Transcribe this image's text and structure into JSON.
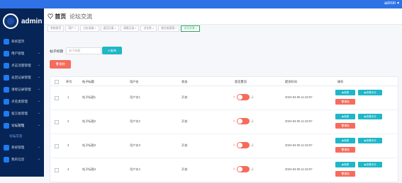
{
  "topbar": {
    "user": "admin ▾"
  },
  "sidebar": {
    "brand": "admin",
    "items": [
      {
        "label": "系统首页",
        "icon": "home-icon",
        "caret": false
      },
      {
        "label": "用户管理",
        "icon": "user-icon",
        "caret": true
      },
      {
        "label": "点击流量管理",
        "icon": "chart-icon",
        "caret": true
      },
      {
        "label": "返回记录管理",
        "icon": "list-icon",
        "caret": true
      },
      {
        "label": "请假记录管理",
        "icon": "doc-icon",
        "caret": true
      },
      {
        "label": "点名类管理",
        "icon": "tag-icon",
        "caret": true
      },
      {
        "label": "留言板管理",
        "icon": "msg-icon",
        "caret": true
      },
      {
        "label": "论坛管理",
        "icon": "forum-icon",
        "caret": true,
        "active": true
      },
      {
        "label": "系统管理",
        "icon": "gear-icon",
        "caret": true
      },
      {
        "label": "我的信息",
        "icon": "profile-icon",
        "caret": true
      }
    ],
    "sub_item": "论坛交流"
  },
  "header": {
    "home": "首页",
    "title": "论坛交流"
  },
  "tabs": [
    "系统首页",
    "用户 ×",
    "点击流量 ×",
    "返回记录 ×",
    "请假记录 ×",
    "点名类 ×",
    "留言板管理 ×",
    "论坛交流 ×"
  ],
  "search": {
    "label": "帖子标题",
    "placeholder": "帖子标题",
    "button": "查询"
  },
  "delete_button": "删除",
  "table": {
    "headers": [
      "",
      "序号",
      "帖子标题",
      "用户名",
      "状态",
      "是否置顶",
      "提交时间",
      "操作"
    ],
    "rows": [
      {
        "no": "1",
        "title": "帖子标题1",
        "user": "用户名1",
        "status": "开放",
        "time": "2024-04-05 11:34:57"
      },
      {
        "no": "2",
        "title": "帖子标题2",
        "user": "用户名2",
        "status": "开放",
        "time": "2024-04-05 11:34:57"
      },
      {
        "no": "3",
        "title": "帖子标题3",
        "user": "用户名3",
        "status": "开放",
        "time": "2024-04-05 11:34:57"
      },
      {
        "no": "4",
        "title": "帖子标题4",
        "user": "用户名4",
        "status": "开放",
        "time": "2024-04-05 11:34:57"
      }
    ],
    "actions": {
      "view": "查看",
      "view_comments": "查看评论",
      "delete": "删除"
    }
  },
  "colors": {
    "sidebar": "#062455",
    "topbar": "#2e72e6",
    "teal": "#1fb6c8",
    "red": "#f56c5c",
    "active_tab": "#2aa760"
  }
}
